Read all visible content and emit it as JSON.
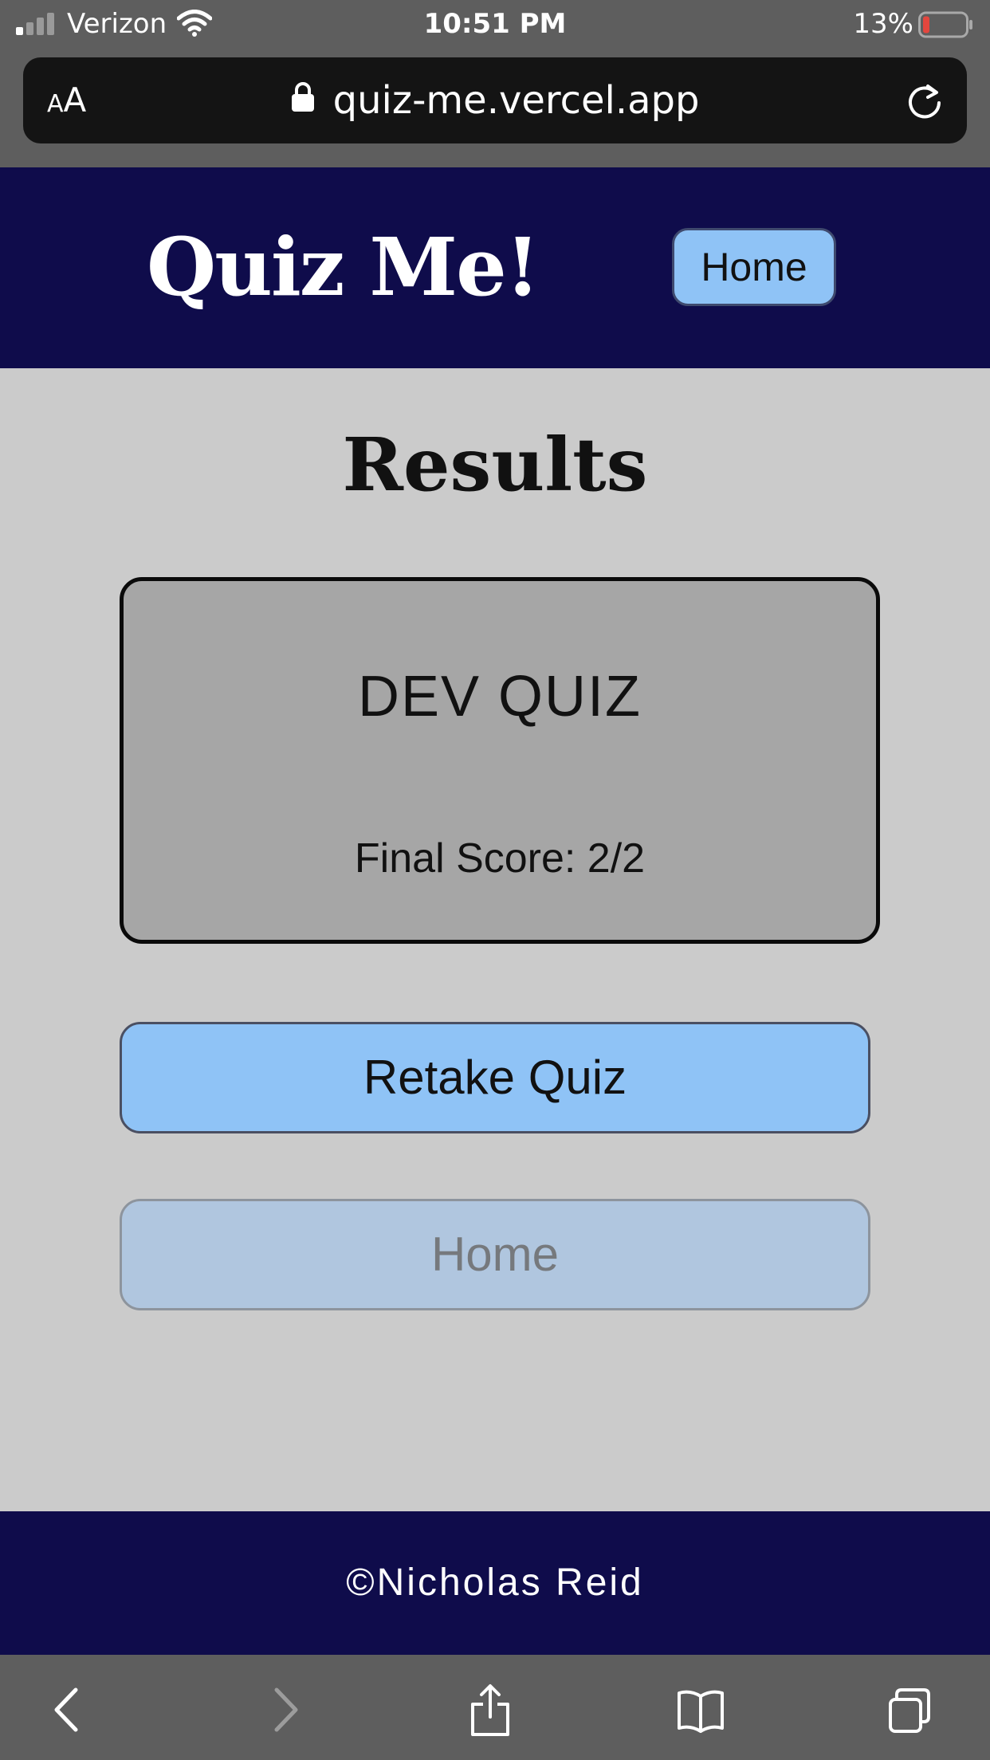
{
  "status_bar": {
    "carrier": "Verizon",
    "time": "10:51 PM",
    "battery_percent": "13%",
    "battery_level": 0.13,
    "signal_bars_active": 1,
    "signal_bars_total": 4,
    "icons": [
      "signal-icon",
      "wifi-icon",
      "battery-icon"
    ]
  },
  "browser": {
    "text_size_small": "A",
    "text_size_large": "A",
    "url": "quiz-me.vercel.app",
    "icons": [
      "lock-icon",
      "reload-icon"
    ]
  },
  "header": {
    "title": "Quiz Me!",
    "home_label": "Home"
  },
  "main": {
    "heading": "Results",
    "card": {
      "quiz_name": "DEV QUIZ",
      "final_score": "Final Score: 2/2"
    },
    "retake_label": "Retake Quiz",
    "home_label": "Home"
  },
  "footer": {
    "credit": "©Nicholas Reid"
  },
  "toolbar": {
    "icons": [
      "back-icon",
      "forward-icon",
      "share-icon",
      "bookmarks-icon",
      "tabs-icon"
    ]
  },
  "colors": {
    "header_bg": "#0f0c4b",
    "page_bg": "#cbcbcb",
    "card_bg": "#a6a6a6",
    "button_primary": "#8fc3f6",
    "button_muted": "#b0c6df",
    "chrome_bg": "#5e5e5e",
    "address_bar_bg": "#141414",
    "battery_low": "#e4463e"
  }
}
